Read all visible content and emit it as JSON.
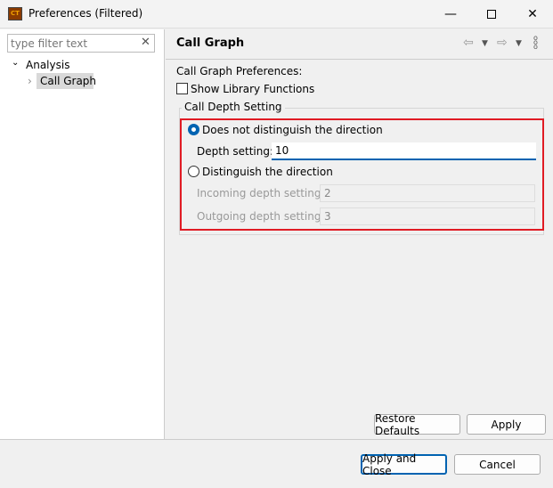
{
  "window": {
    "title": "Preferences (Filtered)",
    "app_icon_text": "CT"
  },
  "filter": {
    "placeholder": "type filter text"
  },
  "tree": {
    "items": [
      {
        "label": "Analysis",
        "expanded": true
      },
      {
        "label": "Call Graph",
        "selected": true
      }
    ]
  },
  "page": {
    "title": "Call Graph",
    "section_label": "Call Graph Preferences:",
    "show_library_functions": {
      "label": "Show Library Functions",
      "checked": false
    },
    "group_label": "Call Depth Setting",
    "radio_no_direction": {
      "label": "Does not distinguish the direction",
      "selected": true
    },
    "depth_setting": {
      "label": "Depth setting:",
      "value": "10"
    },
    "radio_direction": {
      "label": "Distinguish the direction",
      "selected": false
    },
    "incoming": {
      "label": "Incoming depth setting:",
      "value": "2"
    },
    "outgoing": {
      "label": "Outgoing depth setting:",
      "value": "3"
    },
    "restore_defaults": "Restore Defaults",
    "apply": "Apply"
  },
  "footer": {
    "apply_close": "Apply and Close",
    "cancel": "Cancel"
  },
  "colors": {
    "accent": "#0063b1",
    "highlight": "#e01b24"
  }
}
